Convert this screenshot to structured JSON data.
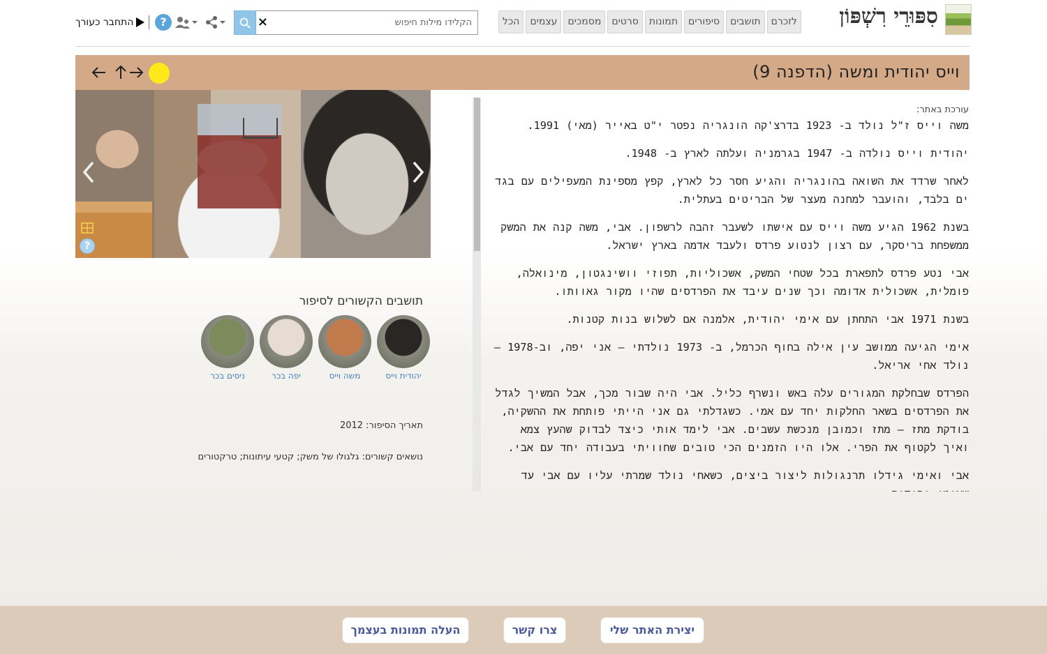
{
  "colors": {
    "title_bar": "#d4a987",
    "footer": "#dccbb8",
    "accent_blue": "#5aa6db",
    "link_blue": "#4a7fb7",
    "yellow_dot": "#ffe81a"
  },
  "header": {
    "logo_text": "סִפּוּרֵי רִשְׁפּוֹן",
    "nav_tabs": [
      "לזכרם",
      "תושבים",
      "סיפורים",
      "תמונות",
      "סרטים",
      "מסמכים",
      "עצמים",
      "הכל"
    ],
    "search_placeholder": "הקלידו מילות חיפוש",
    "search_value": "",
    "clear_glyph": "×",
    "help_glyph": "?",
    "login_label": "התחבר כעורך",
    "icons": [
      "logo-icon",
      "search-icon",
      "share-icon",
      "users-icon",
      "help-icon",
      "login-arrow-icon",
      "close-icon"
    ]
  },
  "story": {
    "title": "וייס יהודית ומשה (הדפנה 9)",
    "author_label": "עורכת באתר:",
    "paragraphs": [
      "משה וייס ז\"ל נולד ב- 1923 בדרצ'קה הונגריה נפטר י\"ט באייר (מאי) 1991.",
      "יהודית וייס נולדה ב- 1947 בגרמניה ועלתה לארץ ב- 1948.",
      "לאחר שרדד את השואה בהונגריה והגיע חסר כל לארץ, קפץ מספינת המעפילים עם בגד ים בלבד, והועבר למחנה מעצר של הבריטים בעתלית.",
      "בשנת 1962 הגיע משה וייס עם אישתו לשעבר זהבה לרשפון. אבי, משה קנה את המשק ממשפחת בריסקר, עם רצון לנטוע פרדס ולעבד אדמה בארץ ישראל.",
      "אבי נטע פרדס לתפארת בכל שטחי המשק, אשכוליות, תפוזי וושינגטון, מינואלה, פומלית, אשכולית אדומה וכך שנים עיבד את הפרדסים שהיו מקור גאוותו.",
      "בשנת 1971 אבי התחתן עם אימי יהודית, אלמנה אם לשלוש בנות קטנות.",
      "אימי הגיעה ממושב עין אילה בחוף הכרמל, ב- 1973 נולדתי – אני יפה, וב-1978 – נולד אחי אריאל.",
      "הפרדס שבחלקת המגורים עלה באש ונשרף כליל. אבי היה שבור מכך, אבל המשיך לגדל את הפרדסים בשאר החלקות יחד עם אמי. כשגדלתי גם אני הייתי פותחת את ההשקיה, בודקת מתז – מתז וכמובן מנכשת עשבים. אבי לימד אותי כיצד לבדוק שהעץ צמא ואיך לקטוף את הפרי. אלו היו הזמנים הכי טובים שחוויתי בעבודה יחד עם אבי.",
      "אבי ואימי גידלו תרנגולות ליצור ביצים, כשאחי נולד שמרתי עליו עם אבי עד שאימי יהודית"
    ]
  },
  "title_controls": {
    "icons": [
      "arrow-left-icon",
      "arrow-up-icon",
      "arrow-right-icon"
    ]
  },
  "gallery": {
    "icons": [
      "chevron-left-icon",
      "chevron-right-icon",
      "grid-icon",
      "help-icon"
    ],
    "help_glyph": "?"
  },
  "related": {
    "heading": "תושבים הקשורים לסיפור",
    "residents": [
      {
        "name": "יהודית וייס",
        "tone": "#2a2623"
      },
      {
        "name": "משה וייס",
        "tone": "#c07a4c"
      },
      {
        "name": "יפה בכר",
        "tone": "#e6dcd2"
      },
      {
        "name": "ניסים בכר",
        "tone": "#7d8a5c"
      }
    ]
  },
  "meta": {
    "date_line": "תאריך הסיפור: 2012",
    "topics_line": "נושאים קשורים: גלגולו של משק; קטעי עיתונות; טרקטורים"
  },
  "footer": {
    "buttons": [
      "יצירת האתר שלי",
      "צרו קשר",
      "העלה תמונות בעצמך"
    ]
  }
}
